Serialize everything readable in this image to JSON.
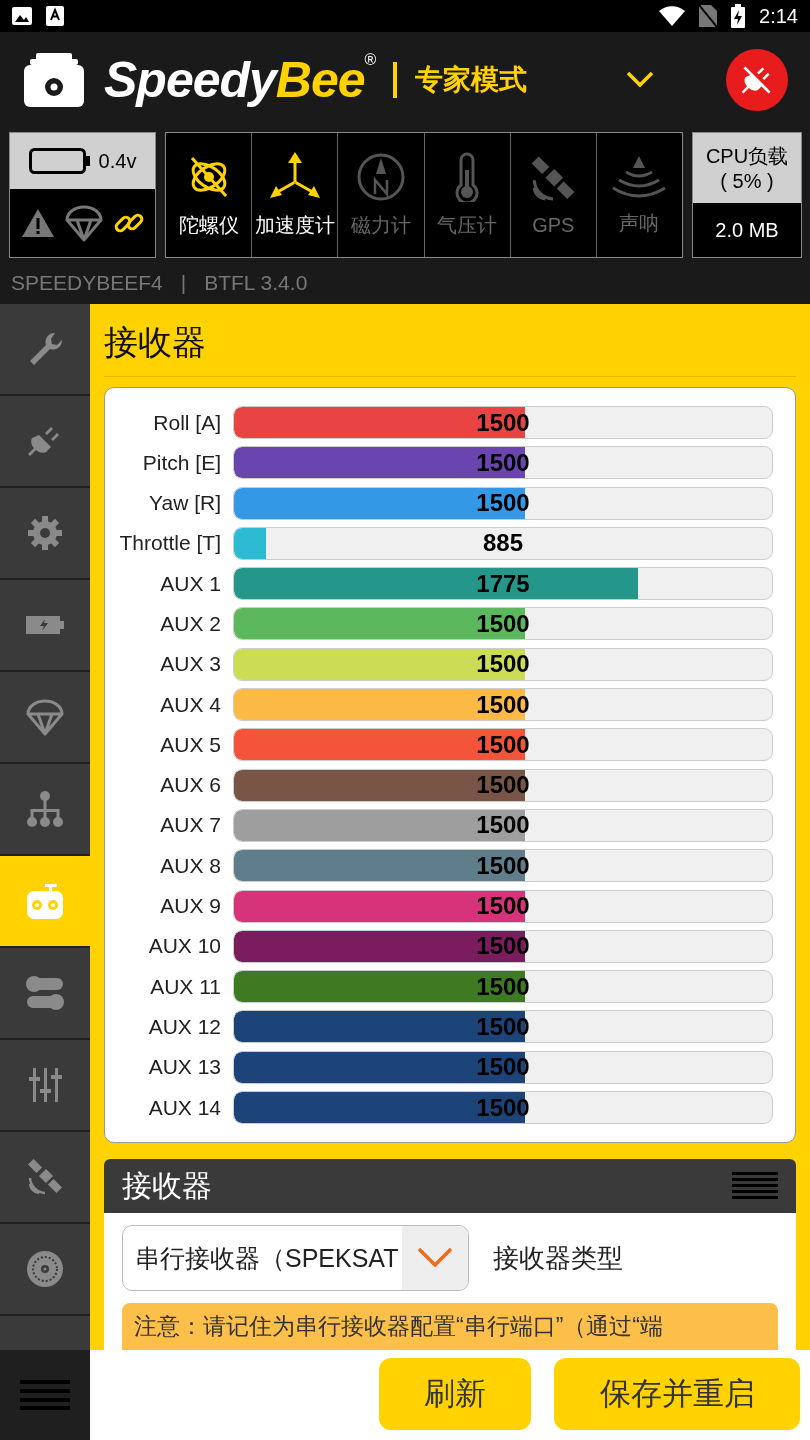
{
  "status_bar": {
    "time": "2:14"
  },
  "header": {
    "brand_a": "Speedy",
    "brand_b": "Bee",
    "brand_mark": "®",
    "mode": "专家模式"
  },
  "battery": {
    "voltage": "0.4v"
  },
  "indicators": [
    {
      "kind": "warning",
      "active": false
    },
    {
      "kind": "parachute",
      "active": false
    },
    {
      "kind": "link",
      "active": true
    }
  ],
  "sensors": [
    {
      "kind": "gyro",
      "label": "陀螺仪",
      "active": true
    },
    {
      "kind": "accel",
      "label": "加速度计",
      "active": true
    },
    {
      "kind": "compass",
      "label": "磁力计",
      "active": false
    },
    {
      "kind": "baro",
      "label": "气压计",
      "active": false
    },
    {
      "kind": "gps",
      "label": "GPS",
      "active": false
    },
    {
      "kind": "sonar",
      "label": "声呐",
      "active": false
    }
  ],
  "cpu": {
    "label": "CPU负载",
    "value": "( 5% )",
    "memory": "2.0 MB"
  },
  "firmware": {
    "board": "SPEEDYBEEF4",
    "separator": "|",
    "version": "BTFL 3.4.0"
  },
  "sidebar": {
    "items": [
      {
        "kind": "wrench",
        "selected": false
      },
      {
        "kind": "plug",
        "selected": false
      },
      {
        "kind": "gear",
        "selected": false
      },
      {
        "kind": "battery",
        "selected": false
      },
      {
        "kind": "parachute",
        "selected": false
      },
      {
        "kind": "tree",
        "selected": false
      },
      {
        "kind": "radio",
        "selected": true
      },
      {
        "kind": "toggles",
        "selected": false
      },
      {
        "kind": "sliders",
        "selected": false
      },
      {
        "kind": "satellite",
        "selected": false
      },
      {
        "kind": "motor",
        "selected": false
      }
    ]
  },
  "page_title": "接收器",
  "channels": [
    {
      "name": "Roll [A]",
      "value": "1500",
      "level": 0.54,
      "color": "#e84444"
    },
    {
      "name": "Pitch [E]",
      "value": "1500",
      "level": 0.54,
      "color": "#6a45b0"
    },
    {
      "name": "Yaw [R]",
      "value": "1500",
      "level": 0.54,
      "color": "#3399e6"
    },
    {
      "name": "Throttle [T]",
      "value": "885",
      "level": 0.06,
      "color": "#2bbcd4"
    },
    {
      "name": "AUX 1",
      "value": "1775",
      "level": 0.75,
      "color": "#24968a"
    },
    {
      "name": "AUX 2",
      "value": "1500",
      "level": 0.54,
      "color": "#5cb85c"
    },
    {
      "name": "AUX 3",
      "value": "1500",
      "level": 0.54,
      "color": "#cddc55"
    },
    {
      "name": "AUX 4",
      "value": "1500",
      "level": 0.54,
      "color": "#fbb945"
    },
    {
      "name": "AUX 5",
      "value": "1500",
      "level": 0.54,
      "color": "#f4553a"
    },
    {
      "name": "AUX 6",
      "value": "1500",
      "level": 0.54,
      "color": "#795548"
    },
    {
      "name": "AUX 7",
      "value": "1500",
      "level": 0.54,
      "color": "#9e9e9e"
    },
    {
      "name": "AUX 8",
      "value": "1500",
      "level": 0.54,
      "color": "#607d8b"
    },
    {
      "name": "AUX 9",
      "value": "1500",
      "level": 0.54,
      "color": "#d6337a"
    },
    {
      "name": "AUX 10",
      "value": "1500",
      "level": 0.54,
      "color": "#7b1c5e"
    },
    {
      "name": "AUX 11",
      "value": "1500",
      "level": 0.54,
      "color": "#3d7a22"
    },
    {
      "name": "AUX 12",
      "value": "1500",
      "level": 0.54,
      "color": "#1d4479"
    },
    {
      "name": "AUX 13",
      "value": "1500",
      "level": 0.54,
      "color": "#1d4479"
    },
    {
      "name": "AUX 14",
      "value": "1500",
      "level": 0.54,
      "color": "#1d4479"
    }
  ],
  "receiver": {
    "title": "接收器",
    "select_value": "串行接收器（SPEKSAT",
    "select_label": "接收器类型",
    "note": "注意：请记住为串行接收器配置“串行端口”（通过“端"
  },
  "buttons": [
    {
      "label": "刷新"
    },
    {
      "label": "保存并重启"
    }
  ]
}
